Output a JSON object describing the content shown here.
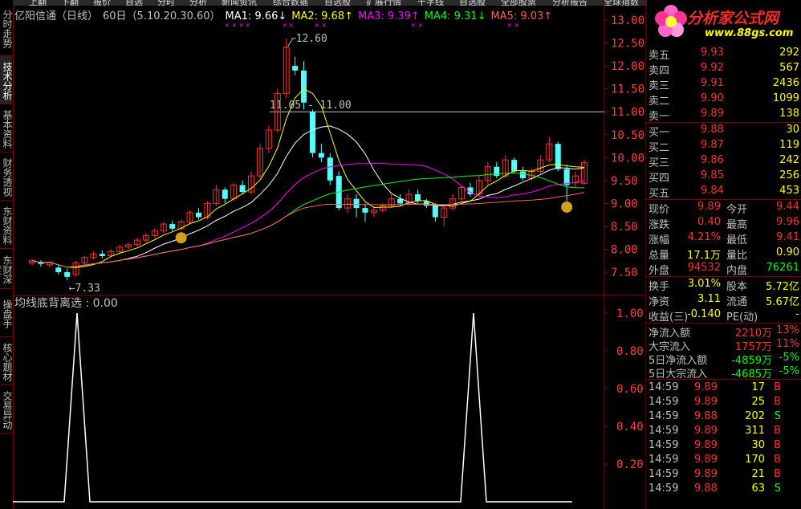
{
  "sidebar": {
    "tabs": [
      "分时走势",
      "技术分析",
      "基本资料",
      "财务透视",
      "东财资料",
      "东财深度",
      "操盘手",
      "核心题材",
      "交易异动"
    ],
    "active": 1
  },
  "menu": [
    "上翻",
    "下翻",
    "报价",
    "自选",
    "分时",
    "分析",
    "新闻资讯",
    "综合数据",
    "自选股",
    "扩展行情",
    "十字线",
    "自选股",
    "全部股票",
    "分析报告",
    "全球指数"
  ],
  "header": {
    "stock": "亿阳信通（日线）",
    "period": "60日（5.10.20.30.60）",
    "ma1": "MA1: 9.66↓",
    "ma2": "MA2: 9.68↑",
    "ma3": "MA3: 9.39↑",
    "ma4": "MA4: 9.31↓",
    "ma5": "MA5: 9.03↑"
  },
  "colors": {
    "ma1": "#ffffff",
    "ma2": "#ffff00",
    "ma3": "#ff00ff",
    "ma4": "#00ff00",
    "ma5": "#ff6060",
    "up": "#ff3030",
    "down": "#54ffff",
    "grid": "#8b0000"
  },
  "price_labels": [
    "13.00",
    "12.50",
    "12.00",
    "11.50",
    "11.00",
    "10.50",
    "10.00",
    "9.50",
    "9.00",
    "8.50",
    "8.00",
    "7.50"
  ],
  "indicator_labels": [
    "1.00",
    "0.80",
    "0.60",
    "0.40",
    "0.20"
  ],
  "annotations": {
    "high": "12.60",
    "low": "7.33",
    "range": "11.05 - 11.00"
  },
  "indicator_title": "均线底背离选 : 0.00",
  "logo": {
    "text": "分析家公式网",
    "url": "www.88gs.com"
  },
  "orderbook": {
    "sell": [
      {
        "label": "卖五",
        "price": "9.93",
        "vol": "292"
      },
      {
        "label": "卖四",
        "price": "9.92",
        "vol": "567"
      },
      {
        "label": "卖三",
        "price": "9.91",
        "vol": "2436"
      },
      {
        "label": "卖二",
        "price": "9.90",
        "vol": "1099"
      },
      {
        "label": "卖一",
        "price": "9.89",
        "vol": "138"
      }
    ],
    "buy": [
      {
        "label": "买一",
        "price": "9.88",
        "vol": "30"
      },
      {
        "label": "买二",
        "price": "9.87",
        "vol": "119"
      },
      {
        "label": "买三",
        "price": "9.86",
        "vol": "242"
      },
      {
        "label": "买四",
        "price": "9.85",
        "vol": "256"
      },
      {
        "label": "买五",
        "price": "9.84",
        "vol": "453"
      }
    ]
  },
  "quote": [
    {
      "l1": "现价",
      "v1": "9.89",
      "l2": "今开",
      "v2": "9.44"
    },
    {
      "l1": "涨跌",
      "v1": "0.40",
      "l2": "最高",
      "v2": "9.96"
    },
    {
      "l1": "涨幅",
      "v1": "4.21%",
      "l2": "最低",
      "v2": "9.41"
    },
    {
      "l1": "总量",
      "v1": "17.1万",
      "l2": "量比",
      "v2": "0.90"
    },
    {
      "l1": "外盘",
      "v1": "94532",
      "l2": "内盘",
      "v2": "76261"
    }
  ],
  "stats": [
    {
      "l1": "换手",
      "v1": "3.01%",
      "l2": "股本",
      "v2": "5.72亿"
    },
    {
      "l1": "净资",
      "v1": "3.11",
      "l2": "流通",
      "v2": "5.67亿"
    },
    {
      "l1": "收益(三)",
      "v1": "-0.140",
      "l2": "PE(动)",
      "v2": "-"
    }
  ],
  "flows": [
    {
      "label": "净流入额",
      "val": "2210万",
      "pct": "13%"
    },
    {
      "label": "大宗流入",
      "val": "1757万",
      "pct": "11%"
    },
    {
      "label": "5日净流入额",
      "val": "-4859万",
      "pct": "-5%"
    },
    {
      "label": "5日大宗流入",
      "val": "-4685万",
      "pct": "-5%"
    }
  ],
  "ticks": [
    {
      "time": "14:59",
      "price": "9.89",
      "vol": "17",
      "side": "B"
    },
    {
      "time": "14:59",
      "price": "9.89",
      "vol": "25",
      "side": "B"
    },
    {
      "time": "14:59",
      "price": "9.88",
      "vol": "202",
      "side": "S"
    },
    {
      "time": "14:59",
      "price": "9.89",
      "vol": "311",
      "side": "B"
    },
    {
      "time": "14:59",
      "price": "9.89",
      "vol": "30",
      "side": "B"
    },
    {
      "time": "14:59",
      "price": "9.89",
      "vol": "170",
      "side": "B"
    },
    {
      "time": "14:59",
      "price": "9.89",
      "vol": "21",
      "side": "B"
    },
    {
      "time": "14:59",
      "price": "9.88",
      "vol": "63",
      "side": "S"
    }
  ]
}
